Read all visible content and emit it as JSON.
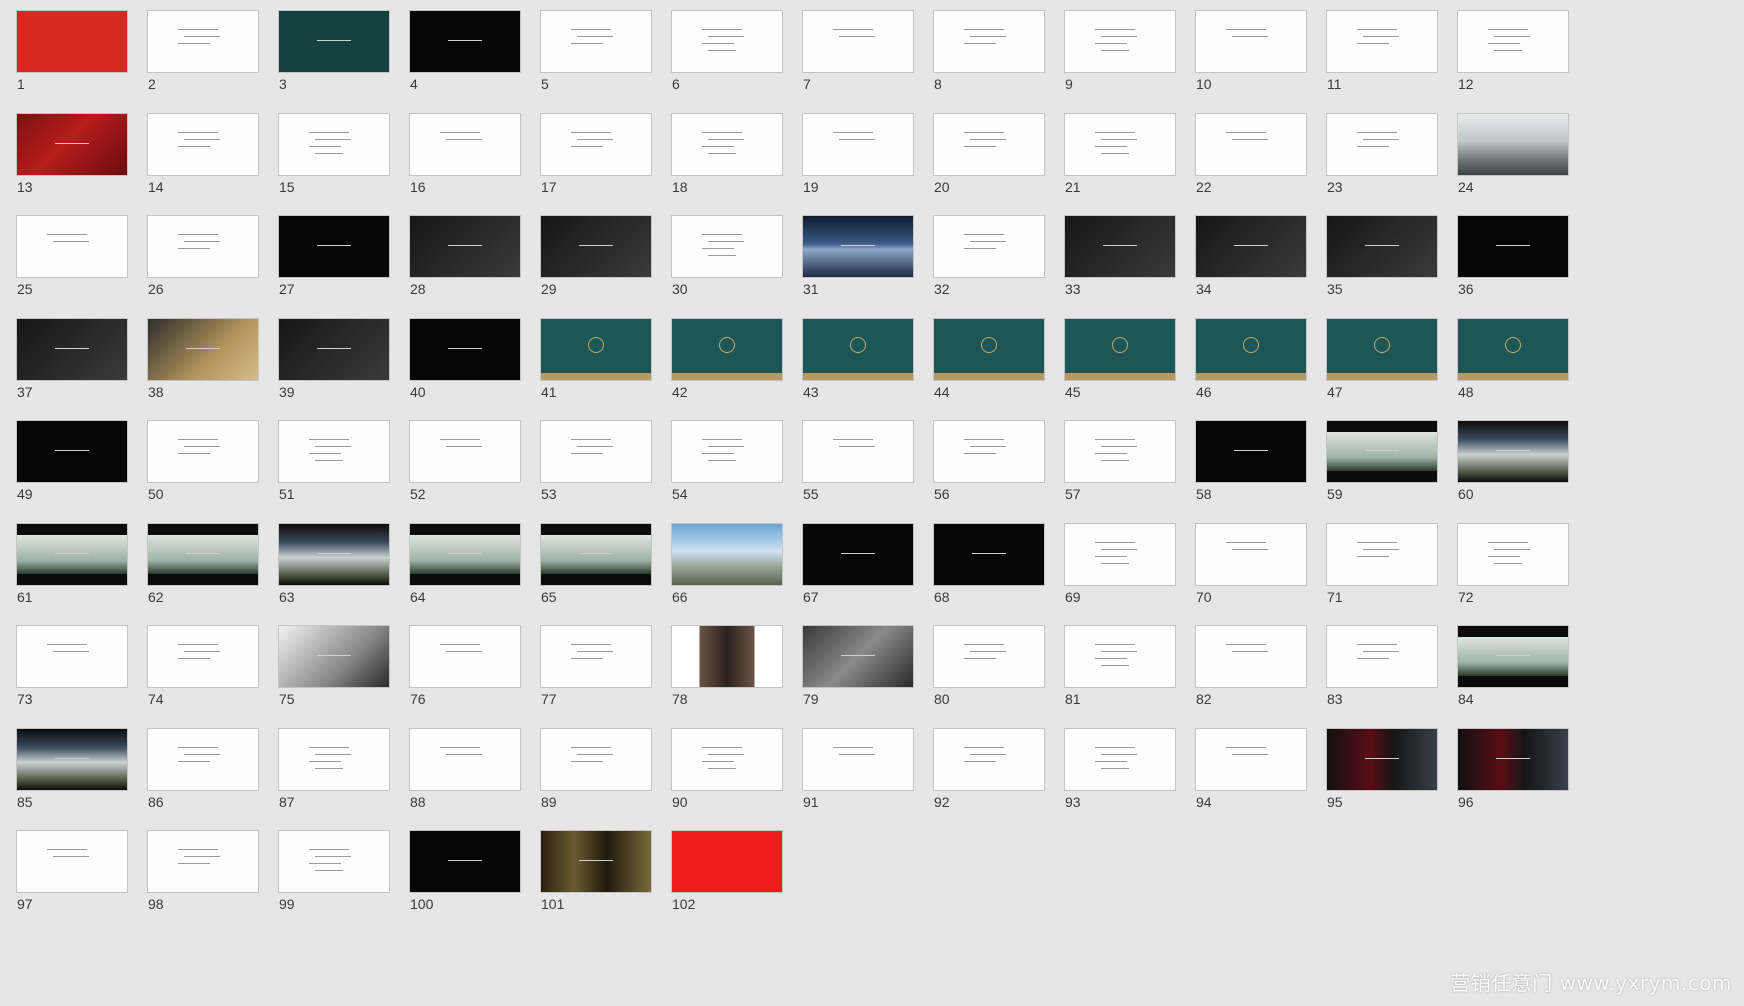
{
  "slides": [
    {
      "number": "1",
      "theme": "red"
    },
    {
      "number": "2",
      "theme": "white"
    },
    {
      "number": "3",
      "theme": "teal-dk"
    },
    {
      "number": "4",
      "theme": "black"
    },
    {
      "number": "5",
      "theme": "white"
    },
    {
      "number": "6",
      "theme": "white"
    },
    {
      "number": "7",
      "theme": "white"
    },
    {
      "number": "8",
      "theme": "white"
    },
    {
      "number": "9",
      "theme": "white"
    },
    {
      "number": "10",
      "theme": "white"
    },
    {
      "number": "11",
      "theme": "white"
    },
    {
      "number": "12",
      "theme": "white"
    },
    {
      "number": "13",
      "theme": "dred"
    },
    {
      "number": "14",
      "theme": "white"
    },
    {
      "number": "15",
      "theme": "white"
    },
    {
      "number": "16",
      "theme": "white"
    },
    {
      "number": "17",
      "theme": "white"
    },
    {
      "number": "18",
      "theme": "white"
    },
    {
      "number": "19",
      "theme": "white"
    },
    {
      "number": "20",
      "theme": "white"
    },
    {
      "number": "21",
      "theme": "white"
    },
    {
      "number": "22",
      "theme": "white"
    },
    {
      "number": "23",
      "theme": "white"
    },
    {
      "number": "24",
      "theme": "mist"
    },
    {
      "number": "25",
      "theme": "white"
    },
    {
      "number": "26",
      "theme": "white"
    },
    {
      "number": "27",
      "theme": "black"
    },
    {
      "number": "28",
      "theme": "dgray"
    },
    {
      "number": "29",
      "theme": "dgray"
    },
    {
      "number": "30",
      "theme": "white"
    },
    {
      "number": "31",
      "theme": "lake"
    },
    {
      "number": "32",
      "theme": "white"
    },
    {
      "number": "33",
      "theme": "dgray"
    },
    {
      "number": "34",
      "theme": "dgray"
    },
    {
      "number": "35",
      "theme": "dgray"
    },
    {
      "number": "36",
      "theme": "black"
    },
    {
      "number": "37",
      "theme": "dgray"
    },
    {
      "number": "38",
      "theme": "gold"
    },
    {
      "number": "39",
      "theme": "dgray"
    },
    {
      "number": "40",
      "theme": "black"
    },
    {
      "number": "41",
      "theme": "teal"
    },
    {
      "number": "42",
      "theme": "teal"
    },
    {
      "number": "43",
      "theme": "teal"
    },
    {
      "number": "44",
      "theme": "teal"
    },
    {
      "number": "45",
      "theme": "teal"
    },
    {
      "number": "46",
      "theme": "teal"
    },
    {
      "number": "47",
      "theme": "teal"
    },
    {
      "number": "48",
      "theme": "teal"
    },
    {
      "number": "49",
      "theme": "black"
    },
    {
      "number": "50",
      "theme": "white"
    },
    {
      "number": "51",
      "theme": "white"
    },
    {
      "number": "52",
      "theme": "white"
    },
    {
      "number": "53",
      "theme": "white"
    },
    {
      "number": "54",
      "theme": "white"
    },
    {
      "number": "55",
      "theme": "white"
    },
    {
      "number": "56",
      "theme": "white"
    },
    {
      "number": "57",
      "theme": "white"
    },
    {
      "number": "58",
      "theme": "black"
    },
    {
      "number": "59",
      "theme": "bill"
    },
    {
      "number": "60",
      "theme": "city"
    },
    {
      "number": "61",
      "theme": "bill"
    },
    {
      "number": "62",
      "theme": "bill"
    },
    {
      "number": "63",
      "theme": "city"
    },
    {
      "number": "64",
      "theme": "bill"
    },
    {
      "number": "65",
      "theme": "bill"
    },
    {
      "number": "66",
      "theme": "sky"
    },
    {
      "number": "67",
      "theme": "black"
    },
    {
      "number": "68",
      "theme": "black"
    },
    {
      "number": "69",
      "theme": "white"
    },
    {
      "number": "70",
      "theme": "white"
    },
    {
      "number": "71",
      "theme": "white"
    },
    {
      "number": "72",
      "theme": "white"
    },
    {
      "number": "73",
      "theme": "white"
    },
    {
      "number": "74",
      "theme": "white"
    },
    {
      "number": "75",
      "theme": "phone"
    },
    {
      "number": "76",
      "theme": "white"
    },
    {
      "number": "77",
      "theme": "white"
    },
    {
      "number": "78",
      "theme": "hall"
    },
    {
      "number": "79",
      "theme": "fabric"
    },
    {
      "number": "80",
      "theme": "white"
    },
    {
      "number": "81",
      "theme": "white"
    },
    {
      "number": "82",
      "theme": "white"
    },
    {
      "number": "83",
      "theme": "white"
    },
    {
      "number": "84",
      "theme": "bill"
    },
    {
      "number": "85",
      "theme": "city"
    },
    {
      "number": "86",
      "theme": "white"
    },
    {
      "number": "87",
      "theme": "white"
    },
    {
      "number": "88",
      "theme": "white"
    },
    {
      "number": "89",
      "theme": "white"
    },
    {
      "number": "90",
      "theme": "white"
    },
    {
      "number": "91",
      "theme": "white"
    },
    {
      "number": "92",
      "theme": "white"
    },
    {
      "number": "93",
      "theme": "white"
    },
    {
      "number": "94",
      "theme": "white"
    },
    {
      "number": "95",
      "theme": "red-dk"
    },
    {
      "number": "96",
      "theme": "red-dk"
    },
    {
      "number": "97",
      "theme": "white"
    },
    {
      "number": "98",
      "theme": "white"
    },
    {
      "number": "99",
      "theme": "white"
    },
    {
      "number": "100",
      "theme": "black"
    },
    {
      "number": "101",
      "theme": "forest"
    },
    {
      "number": "102",
      "theme": "bred"
    }
  ],
  "watermark": "营销任意门 www.yxrym.com",
  "colors": {
    "background": "#e6e6e6",
    "thumb_border": "#c4c4c4",
    "number_text": "#3a3a3a",
    "brand_teal": "#1c5656",
    "brand_gold": "#b69a63",
    "brand_red": "#d7291f"
  }
}
